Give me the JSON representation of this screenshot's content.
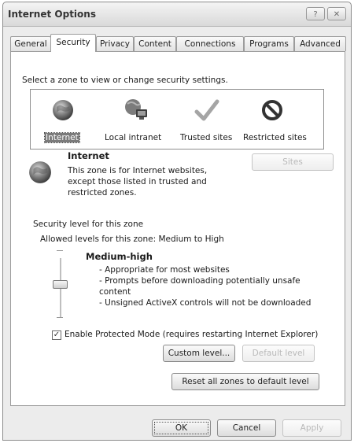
{
  "window": {
    "title": "Internet Options",
    "help_glyph": "?",
    "close_glyph": "✕"
  },
  "tabs": [
    {
      "label": "General"
    },
    {
      "label": "Security"
    },
    {
      "label": "Privacy"
    },
    {
      "label": "Content"
    },
    {
      "label": "Connections"
    },
    {
      "label": "Programs"
    },
    {
      "label": "Advanced"
    }
  ],
  "zones": {
    "prompt": "Select a zone to view or change security settings.",
    "items": [
      {
        "label": "Internet",
        "icon": "globe-icon",
        "selected": true
      },
      {
        "label": "Local intranet",
        "icon": "intranet-icon"
      },
      {
        "label": "Trusted sites",
        "icon": "checkmark-icon"
      },
      {
        "label": "Restricted sites",
        "icon": "no-entry-icon"
      }
    ]
  },
  "zone_info": {
    "name": "Internet",
    "description_lines": [
      "This zone is for Internet websites,",
      "except those listed in trusted and",
      "restricted zones."
    ],
    "sites_button": "Sites"
  },
  "security_level": {
    "group_label": "Security level for this zone",
    "allowed": "Allowed levels for this zone: Medium to High",
    "level_name": "Medium-high",
    "bullets": [
      "- Appropriate for most websites",
      "- Prompts before downloading potentially unsafe",
      "content",
      "- Unsigned ActiveX controls will not be downloaded"
    ],
    "slider_level": "Medium-high"
  },
  "protected_mode": {
    "checked": true,
    "label": "Enable Protected Mode (requires restarting Internet Explorer)"
  },
  "buttons": {
    "custom_level": "Custom level...",
    "default_level": "Default level",
    "reset_all": "Reset all zones to default level",
    "ok": "OK",
    "cancel": "Cancel",
    "apply": "Apply"
  },
  "colors": {
    "selection": "#7b7b7b",
    "restricted_red": "#333333",
    "trusted_green": "#9a9a9a"
  }
}
